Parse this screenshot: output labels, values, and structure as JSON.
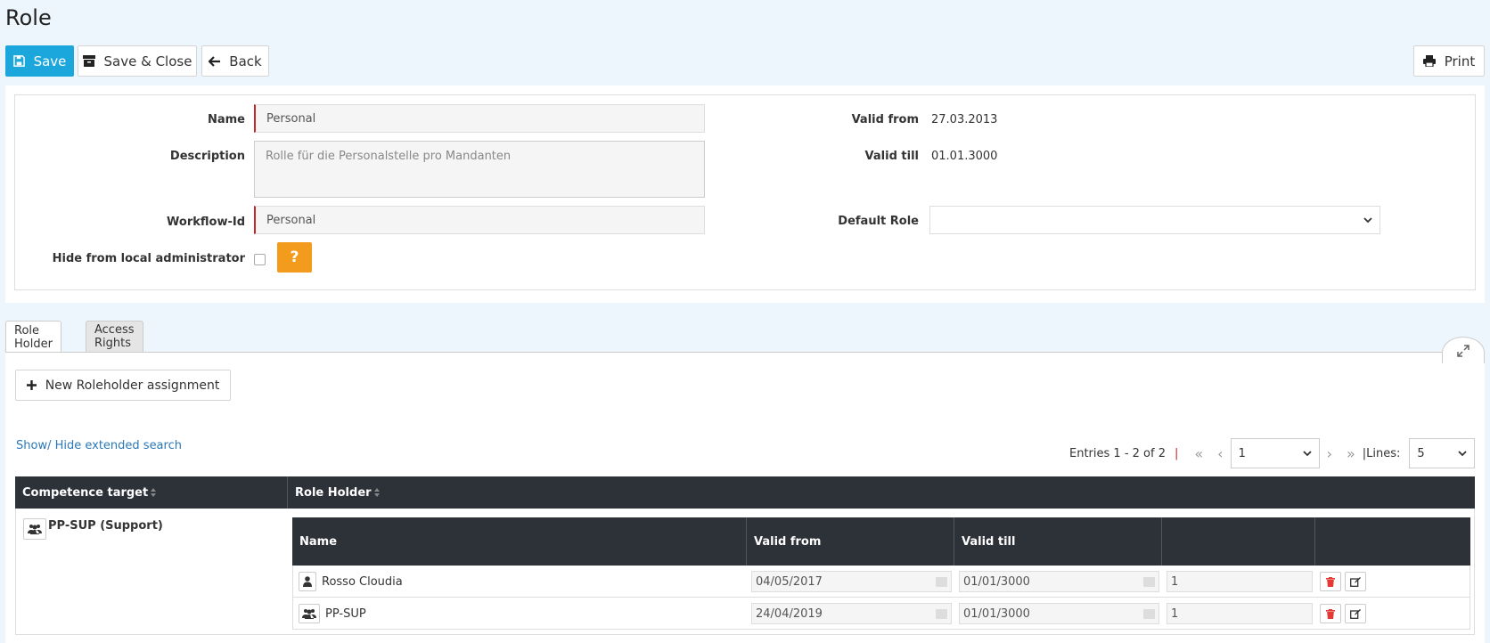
{
  "page": {
    "title": "Role"
  },
  "toolbar": {
    "save": "Save",
    "save_close": "Save & Close",
    "back": "Back",
    "print": "Print"
  },
  "form": {
    "name_label": "Name",
    "name_value": "Personal",
    "description_label": "Description",
    "description_value": "Rolle für die Personalstelle pro Mandanten",
    "workflow_label": "Workflow-Id",
    "workflow_value": "Personal",
    "hide_label": "Hide from local administrator",
    "help": "?",
    "valid_from_label": "Valid from",
    "valid_from_value": "27.03.2013",
    "valid_till_label": "Valid till",
    "valid_till_value": "01.01.3000",
    "default_role_label": "Default Role",
    "default_role_value": ""
  },
  "tabs": [
    {
      "label": "Role Holder",
      "active": true
    },
    {
      "label": "Access Rights",
      "active": false
    }
  ],
  "actions": {
    "new_assignment": "New Roleholder assignment",
    "extended_search": "Show/ Hide extended search"
  },
  "pager": {
    "entries": "Entries 1 - 2 of 2",
    "separator": "|",
    "page": "1",
    "lines_label": "|Lines:",
    "lines": "5"
  },
  "grid": {
    "col_competence": "Competence target",
    "col_role_holder": "Role Holder",
    "group": "PP-SUP (Support)",
    "inner_cols": {
      "name": "Name",
      "valid_from": "Valid from",
      "valid_till": "Valid till"
    },
    "rows": [
      {
        "name": "Rosso Cloudia",
        "type": "person",
        "from": "04/05/2017",
        "till": "01/01/3000",
        "num": "1"
      },
      {
        "name": "PP-SUP",
        "type": "group",
        "from": "24/04/2019",
        "till": "01/01/3000",
        "num": "1"
      }
    ]
  },
  "colors": {
    "primary": "#1ba6dc",
    "warning": "#f29b1d",
    "header": "#2d3138",
    "danger": "#e53935",
    "link": "#2b78b8"
  }
}
